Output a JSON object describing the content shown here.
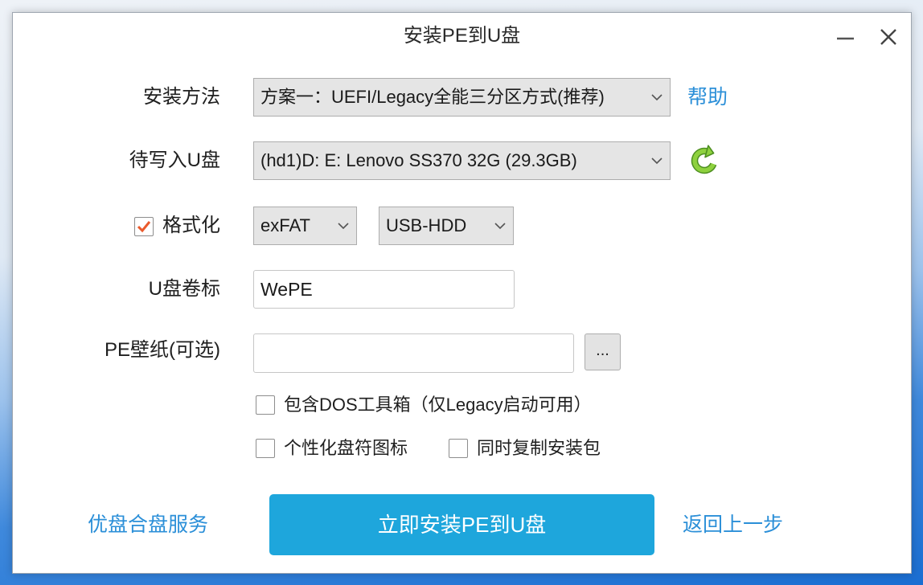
{
  "window": {
    "title": "安装PE到U盘"
  },
  "form": {
    "install_method": {
      "label": "安装方法",
      "value": "方案一：UEFI/Legacy全能三分区方式(推荐)",
      "help_link": "帮助"
    },
    "target_disk": {
      "label": "待写入U盘",
      "value": "(hd1)D: E: Lenovo SS370 32G (29.3GB)"
    },
    "format": {
      "label": "格式化",
      "checked": true,
      "filesystem": "exFAT",
      "mode": "USB-HDD"
    },
    "volume_label": {
      "label": "U盘卷标",
      "value": "WePE"
    },
    "wallpaper": {
      "label": "PE壁纸(可选)",
      "value": "",
      "browse_label": "..."
    },
    "options": {
      "dos_toolbox": {
        "label": "包含DOS工具箱（仅Legacy启动可用）",
        "checked": false
      },
      "custom_drive_icon": {
        "label": "个性化盘符图标",
        "checked": false
      },
      "copy_package": {
        "label": "同时复制安装包",
        "checked": false
      }
    }
  },
  "footer": {
    "left_link": "优盘合盘服务",
    "primary_button": "立即安装PE到U盘",
    "back_link": "返回上一步"
  },
  "icons": {
    "minimize": "minimize-icon",
    "close": "close-icon",
    "dropdown": "chevron-down-icon",
    "refresh": "refresh-icon",
    "checkmark": "checkmark-icon"
  },
  "colors": {
    "primary_button": "#1ea6dc",
    "link": "#2b8fd8",
    "checkmark": "#ea5a2c",
    "refresh_icon": "#8ed13e"
  }
}
